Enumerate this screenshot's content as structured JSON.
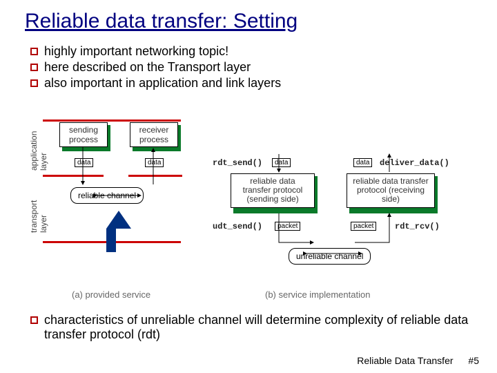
{
  "title": "Reliable data transfer: Setting",
  "bullets": [
    "highly important networking topic!",
    "here described on the Transport layer",
    "also important in application and link layers"
  ],
  "diagram": {
    "layers": {
      "application": "application\nlayer",
      "transport": "transport\nlayer"
    },
    "left": {
      "sending": "sending\nprocess",
      "receiver": "receiver\nprocess",
      "data": "data",
      "channel": "reliable channel",
      "caption": "(a)  provided service"
    },
    "right": {
      "api_rdt_send": "rdt_send()",
      "api_deliver": "deliver_data()",
      "proto_send": "reliable data\ntransfer protocol\n(sending side)",
      "proto_recv": "reliable data\ntransfer protocol\n(receiving side)",
      "api_udt_send": "udt_send()",
      "api_rdt_rcv": "rdt_rcv()",
      "data": "data",
      "packet": "packet",
      "channel": "unreliable channel",
      "caption": "(b)  service implementation"
    }
  },
  "bottom_bullet": "characteristics of unreliable channel will determine complexity of reliable data transfer protocol (rdt)",
  "footer": {
    "label": "Reliable Data Transfer",
    "page": "#5"
  }
}
